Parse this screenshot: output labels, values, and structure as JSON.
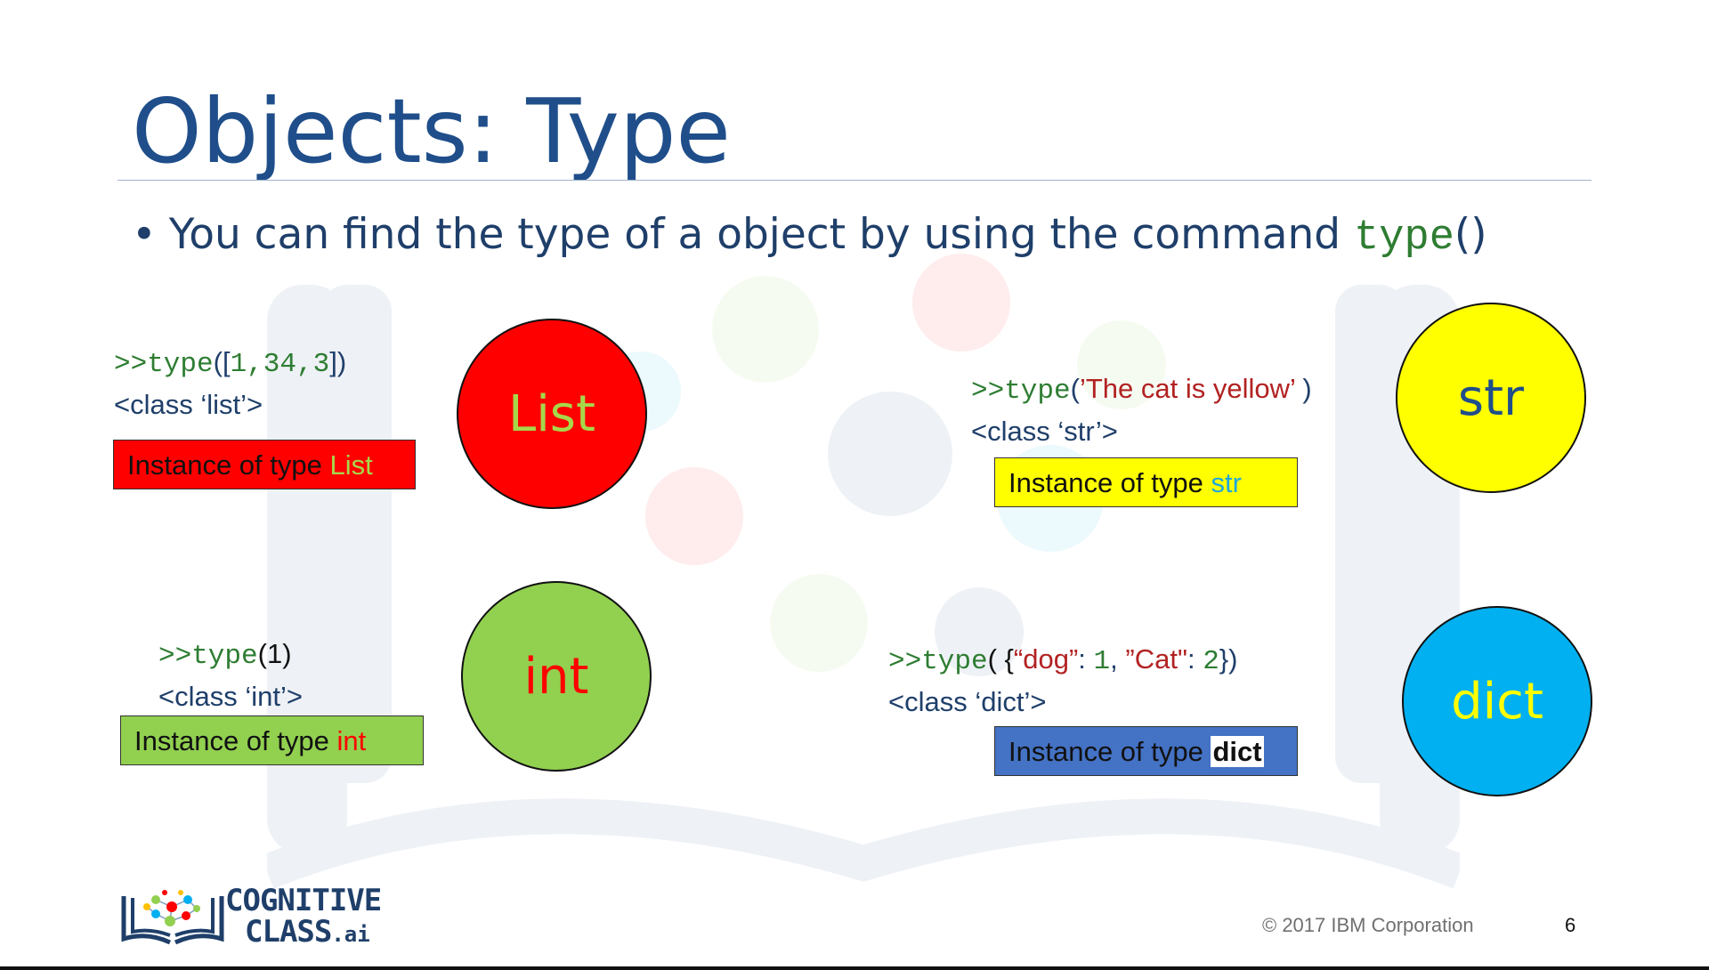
{
  "title": "Objects: Type",
  "bullet": {
    "marker": "•",
    "text": "You can find the type of a object by using the command ",
    "code": "type",
    "suffix": "()"
  },
  "examples": {
    "list": {
      "prompt": ">>type",
      "open": "(",
      "bracket_open": "[",
      "args": "1,34,3",
      "bracket_close": "]",
      "close": ")",
      "result": "<class ‘list’>",
      "box_prefix": "Instance of type ",
      "box_accent": "List",
      "circle_label": "List"
    },
    "int": {
      "prompt": ">>type",
      "open": "(",
      "args": "1",
      "close": ")",
      "result": "<class ‘int’>",
      "box_prefix": "Instance of type ",
      "box_accent": "int",
      "circle_label": "int"
    },
    "str": {
      "prompt": ">>type",
      "open": "(",
      "args": "’The cat is yellow’",
      "close": " )",
      "result": "<class ‘str’>",
      "box_prefix": "Instance of type ",
      "box_accent": "str",
      "circle_label": "str"
    },
    "dict": {
      "prompt": ">>type",
      "open": "( {",
      "key1": "“dog”",
      "colon1": ": ",
      "val1": "1",
      "comma": ", ",
      "key2": "”Cat\"",
      "colon2": ": ",
      "val2": "2",
      "close": "})",
      "result": "<class ‘dict’>",
      "box_prefix": "Instance of type ",
      "box_accent": "dict",
      "circle_label": "dict"
    }
  },
  "logo": {
    "line1": "COGNITIVE",
    "line2": "CLASS",
    "suffix": ".ai"
  },
  "footer": {
    "copyright": "© 2017 IBM Corporation",
    "page_number": "6"
  },
  "colors": {
    "title": "#1f4e8a",
    "red": "#ff0000",
    "green": "#92d050",
    "yellow": "#ffff00",
    "blue_box": "#4472c4",
    "blue_circle": "#00b0f0"
  }
}
